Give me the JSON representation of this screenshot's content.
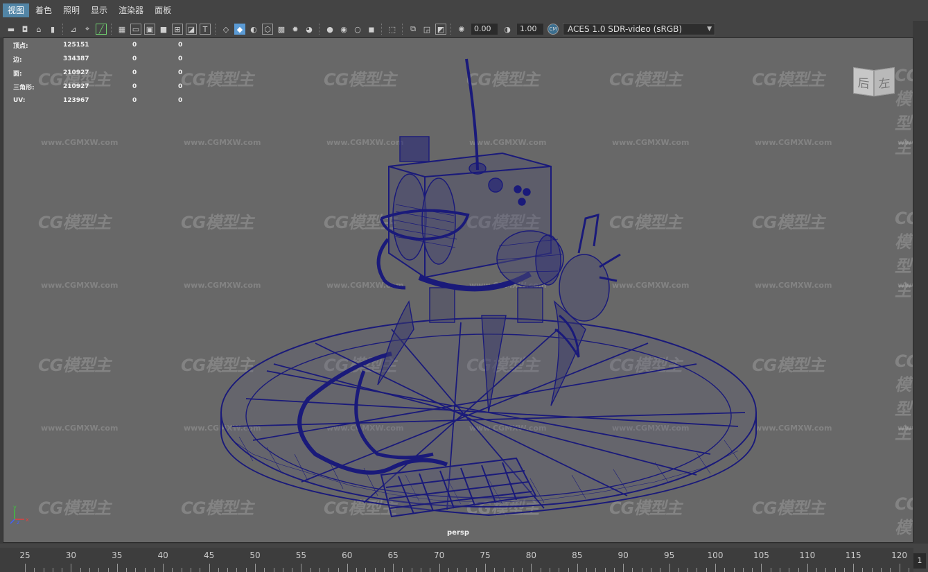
{
  "menu": {
    "items": [
      {
        "label": "视图",
        "active": true
      },
      {
        "label": "着色",
        "active": false
      },
      {
        "label": "照明",
        "active": false
      },
      {
        "label": "显示",
        "active": false
      },
      {
        "label": "渲染器",
        "active": false
      },
      {
        "label": "面板",
        "active": false
      }
    ]
  },
  "toolbar": {
    "exposure_value": "0.00",
    "gamma_value": "1.00",
    "colorspace_label": "ACES 1.0 SDR-video (sRGB)"
  },
  "hud": {
    "rows": [
      {
        "label": "顶点:",
        "value": "125151",
        "col2": "0",
        "col3": "0"
      },
      {
        "label": "边:",
        "value": "334387",
        "col2": "0",
        "col3": "0"
      },
      {
        "label": "面:",
        "value": "210927",
        "col2": "0",
        "col3": "0"
      },
      {
        "label": "三角形:",
        "value": "210927",
        "col2": "0",
        "col3": "0"
      },
      {
        "label": "UV:",
        "value": "123967",
        "col2": "0",
        "col3": "0"
      }
    ]
  },
  "viewport": {
    "camera_label": "persp",
    "watermark_text": "CG模型主",
    "watermark_url": "www.CGMXW.com",
    "viewcube": {
      "face_back": "后",
      "face_left": "左"
    },
    "axis": {
      "x": "x",
      "y": "y",
      "z": "z"
    },
    "wire_color": "#1a1a7a"
  },
  "timeline": {
    "ticks": [
      "25",
      "30",
      "35",
      "40",
      "45",
      "50",
      "55",
      "60",
      "65",
      "70",
      "75",
      "80",
      "85",
      "90",
      "95",
      "100",
      "105",
      "110",
      "115",
      "120"
    ],
    "current_frame": "1"
  },
  "icons": {
    "camera": "camera-icon",
    "bookmark": "bookmark-icon",
    "grid": "grid-icon",
    "wireframe": "wireframe-cube-icon",
    "shaded": "shaded-cube-icon",
    "light": "light-bulb-icon",
    "exposure": "exposure-icon",
    "gamma": "gamma-icon",
    "colorspace": "color-management-icon"
  }
}
